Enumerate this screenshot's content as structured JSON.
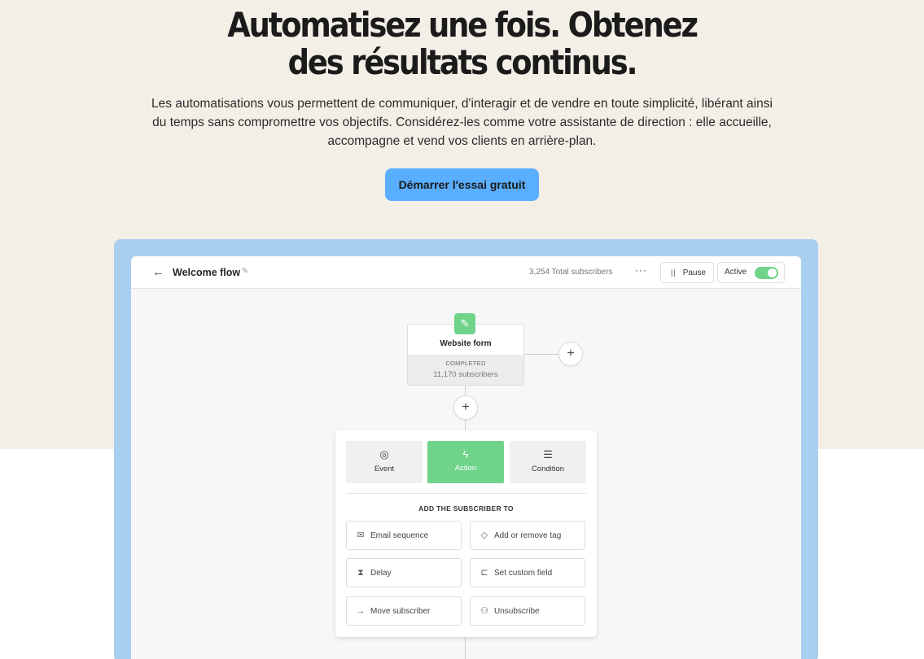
{
  "hero": {
    "headline_line1": "Automatisez une fois. Obtenez",
    "headline_line2": "des résultats continus.",
    "subtext": "Les automatisations vous permettent de communiquer, d'interagir et de vendre en toute simplicité, libérant ainsi du temps sans compromettre vos objectifs. Considérez-les comme votre assistante de direction : elle accueille, accompagne et vend vos clients en arrière-plan.",
    "cta_label": "Démarrer l'essai gratuit"
  },
  "app": {
    "back_icon": "←",
    "flow_title": "Welcome flow",
    "edit_icon": "✎",
    "subscribers_total": "3,254 Total subscribers",
    "more_icon": "···",
    "pause_icon": "||",
    "pause_label": "Pause",
    "active_label": "Active",
    "active_toggle_on": true
  },
  "trigger": {
    "icon": "✎",
    "title": "Website form",
    "status": "COMPLETED",
    "subscribers": "11,170 subscribers"
  },
  "add_buttons": {
    "plus": "+"
  },
  "panel": {
    "tabs": [
      {
        "icon": "◎",
        "label": "Event"
      },
      {
        "icon": "ϟ",
        "label": "Action"
      },
      {
        "icon": "☰",
        "label": "Condition"
      }
    ],
    "section_title": "ADD THE SUBSCRIBER TO",
    "options": [
      {
        "icon": "✉",
        "label": "Email sequence"
      },
      {
        "icon": "◇",
        "label": "Add or remove tag"
      },
      {
        "icon": "⧗",
        "label": "Delay"
      },
      {
        "icon": "⊏",
        "label": "Set custom field"
      },
      {
        "icon": "→",
        "label": "Move subscriber"
      },
      {
        "icon": "⚇",
        "label": "Unsubscribe"
      }
    ]
  },
  "colors": {
    "hero_bg": "#f3efe7",
    "cta_bg": "#5aaeff",
    "frame_bg": "#a9cff0",
    "accent_green": "#6fd38a"
  }
}
